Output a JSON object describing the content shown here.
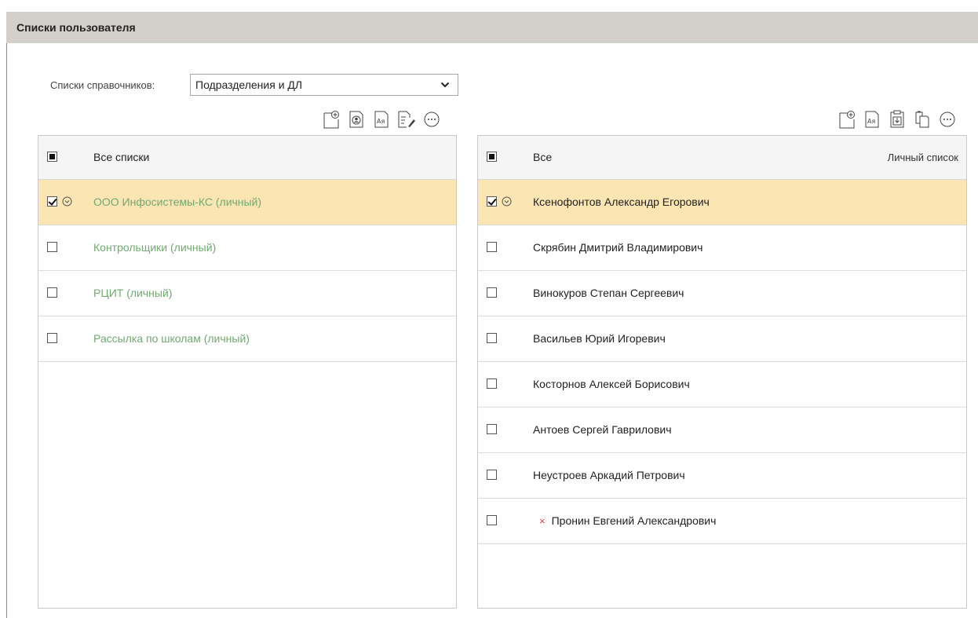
{
  "window": {
    "title": "Списки пользователя"
  },
  "dictionary": {
    "label": "Списки справочников:",
    "selected": "Подразделения и ДЛ"
  },
  "left_toolbar": {
    "icons": [
      "new-list-icon",
      "contact-card-icon",
      "sort-alpha-icon",
      "edit-list-icon",
      "more-icon"
    ]
  },
  "right_toolbar": {
    "icons": [
      "new-list-icon",
      "sort-alpha-icon",
      "paste-import-icon",
      "copy-icon",
      "more-icon"
    ]
  },
  "left_panel": {
    "header": "Все списки",
    "rows": [
      {
        "label": "ООО Инфосистемы-КС (личный)",
        "checked": true,
        "selected": true
      },
      {
        "label": "Контрольщики (личный)",
        "checked": false,
        "selected": false
      },
      {
        "label": "РЦИТ (личный)",
        "checked": false,
        "selected": false
      },
      {
        "label": "Рассылка по школам (личный)",
        "checked": false,
        "selected": false
      }
    ]
  },
  "right_panel": {
    "header": "Все",
    "header_right": "Личный список",
    "rows": [
      {
        "label": "Ксенофонтов Александр Егорович",
        "checked": true,
        "selected": true,
        "removed": false
      },
      {
        "label": "Скрябин Дмитрий Владимирович",
        "checked": false,
        "selected": false,
        "removed": false
      },
      {
        "label": "Винокуров Степан Сергеевич",
        "checked": false,
        "selected": false,
        "removed": false
      },
      {
        "label": "Васильев Юрий Игоревич",
        "checked": false,
        "selected": false,
        "removed": false
      },
      {
        "label": "Косторнов Алексей Борисович",
        "checked": false,
        "selected": false,
        "removed": false
      },
      {
        "label": "Антоев Сергей Гаврилович",
        "checked": false,
        "selected": false,
        "removed": false
      },
      {
        "label": "Неустроев Аркадий Петрович",
        "checked": false,
        "selected": false,
        "removed": false
      },
      {
        "label": "Пронин Евгений Александрович",
        "checked": false,
        "selected": false,
        "removed": true
      }
    ]
  },
  "colors": {
    "title_bg": "#d3d0c9",
    "selected_row": "#fbe6b3",
    "list_link": "#72a872",
    "removed_mark": "#e04040"
  }
}
